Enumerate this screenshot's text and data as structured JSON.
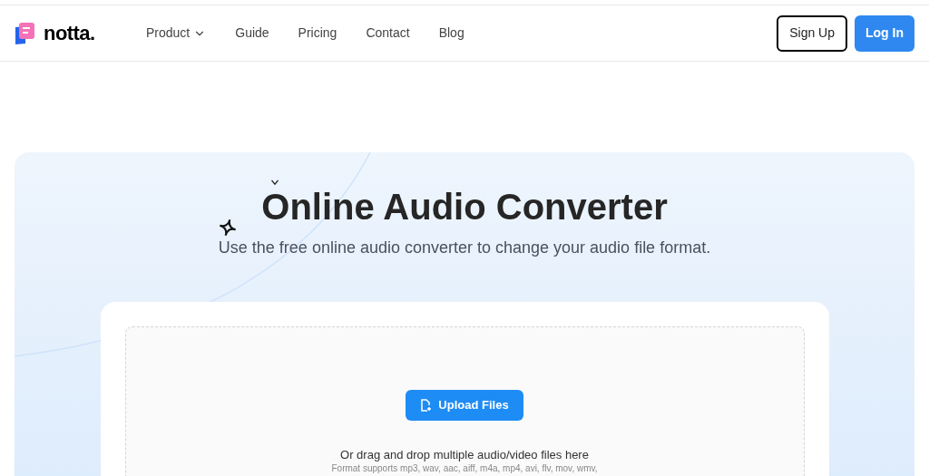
{
  "header": {
    "logo": "notta.",
    "nav": [
      {
        "label": "Product",
        "dropdown": true
      },
      {
        "label": "Guide",
        "dropdown": false
      },
      {
        "label": "Pricing",
        "dropdown": false
      },
      {
        "label": "Contact",
        "dropdown": false
      },
      {
        "label": "Blog",
        "dropdown": false
      }
    ],
    "sign_up": "Sign Up",
    "log_in": "Log In"
  },
  "hero": {
    "title": "Online Audio Converter",
    "subtitle": "Use the free online audio converter to change your audio file format."
  },
  "upload": {
    "button": "Upload Files",
    "hint": "Or drag and drop multiple audio/video files here",
    "formats": "Format supports mp3, wav, aac, aiff, m4a, mp4, avi, flv, mov, wmv,"
  }
}
